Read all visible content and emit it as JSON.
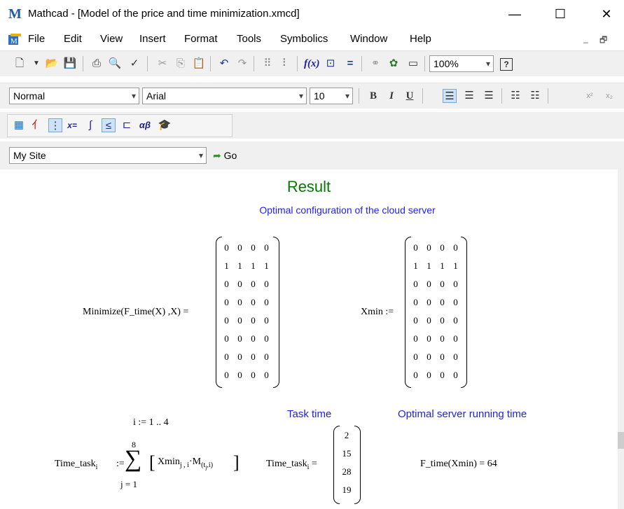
{
  "window": {
    "title": "Mathcad - [Model of the price and time minimization.xmcd]",
    "logo": "M",
    "minimize": "—",
    "maximize": "☐",
    "close": "✕"
  },
  "menu": {
    "items": [
      "File",
      "Edit",
      "View",
      "Insert",
      "Format",
      "Tools",
      "Symbolics",
      "Window",
      "Help"
    ],
    "mdi": [
      "_",
      "🗗"
    ]
  },
  "toolbar": {
    "zoom": "100%"
  },
  "format_bar": {
    "style": "Normal",
    "font": "Arial",
    "size": "10",
    "bold": "B",
    "italic": "I",
    "underline": "U"
  },
  "math_bar": {
    "icons": [
      "calculator-icon",
      "graph-icon",
      "matrix-icon",
      "evaluation-icon",
      "calculus-icon",
      "boolean-icon",
      "programming-icon",
      "greek-icon",
      "symbolic-icon"
    ]
  },
  "resource_bar": {
    "site": "My Site",
    "go": "Go"
  },
  "document": {
    "result_title": "Result",
    "optimal_config": "Optimal configuration of the cloud server",
    "minimize_expr": "Minimize(F_time(X) ,X) =",
    "xmin_label": "Xmin :=",
    "matrix": [
      [
        "0",
        "0",
        "0",
        "0"
      ],
      [
        "1",
        "1",
        "1",
        "1"
      ],
      [
        "0",
        "0",
        "0",
        "0"
      ],
      [
        "0",
        "0",
        "0",
        "0"
      ],
      [
        "0",
        "0",
        "0",
        "0"
      ],
      [
        "0",
        "0",
        "0",
        "0"
      ],
      [
        "0",
        "0",
        "0",
        "0"
      ],
      [
        "0",
        "0",
        "0",
        "0"
      ]
    ],
    "range_def": "i := 1 .. 4",
    "task_time_label": "Task time",
    "optimal_running_label": "Optimal server running time",
    "time_task_def_lhs": "Time_task",
    "sub_i": "i",
    "assign": ":=",
    "sum_upper": "8",
    "sum_lower": "j = 1",
    "sum_body_a": "Xmin",
    "sum_body_sub": "j , i",
    "sum_body_m": "M",
    "sum_body_msub": "(t",
    "sum_body_msub2": "j",
    "sum_body_msub3": ",i)",
    "time_task_eval_lhs": "Time_task",
    "equals": "=",
    "task_vector": [
      "2",
      "15",
      "28",
      "19"
    ],
    "f_time_result": "F_time(Xmin) = 64"
  },
  "colors": {
    "green": "#007a00",
    "blue": "#1f1fe6"
  }
}
